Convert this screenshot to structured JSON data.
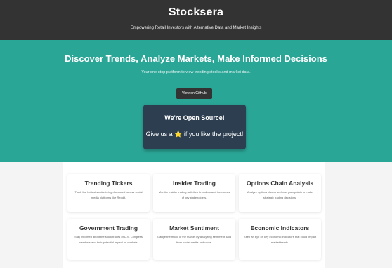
{
  "header": {
    "title": "Stocksera",
    "tagline": "Empowering Retail Investors with Alternative Data and Market Insights"
  },
  "hero": {
    "title": "Discover Trends, Analyze Markets, Make Informed Decisions",
    "subtitle": "Your one-stop platform to view trending stocks and market data.",
    "github_button": "View on GitHub"
  },
  "open_source": {
    "title": "We're Open Source!",
    "body_before": "Give us a",
    "star_glyph": "⭐",
    "body_after": "if you like the project!"
  },
  "features": [
    {
      "title": "Trending Tickers",
      "description": "Track the hottest stocks being discussed across social media platforms like Reddit."
    },
    {
      "title": "Insider Trading",
      "description": "Monitor insider trading activities to understand the moves of key stakeholders."
    },
    {
      "title": "Options Chain Analysis",
      "description": "Analyze options chains and max pain points to make strategic trading decisions."
    },
    {
      "title": "Government Trading",
      "description": "Stay informed about the stock trades of U.S. Congress members and their potential impact on markets."
    },
    {
      "title": "Market Sentiment",
      "description": "Gauge the mood of the market by analyzing sentiment data from social media and news."
    },
    {
      "title": "Economic Indicators",
      "description": "Keep an eye on key economic indicators that could impact market trends."
    }
  ],
  "colors": {
    "header_bg": "#333333",
    "hero_bg": "#2aa697",
    "open_source_card_bg": "#2c3e50",
    "star": "#f4c20d"
  }
}
